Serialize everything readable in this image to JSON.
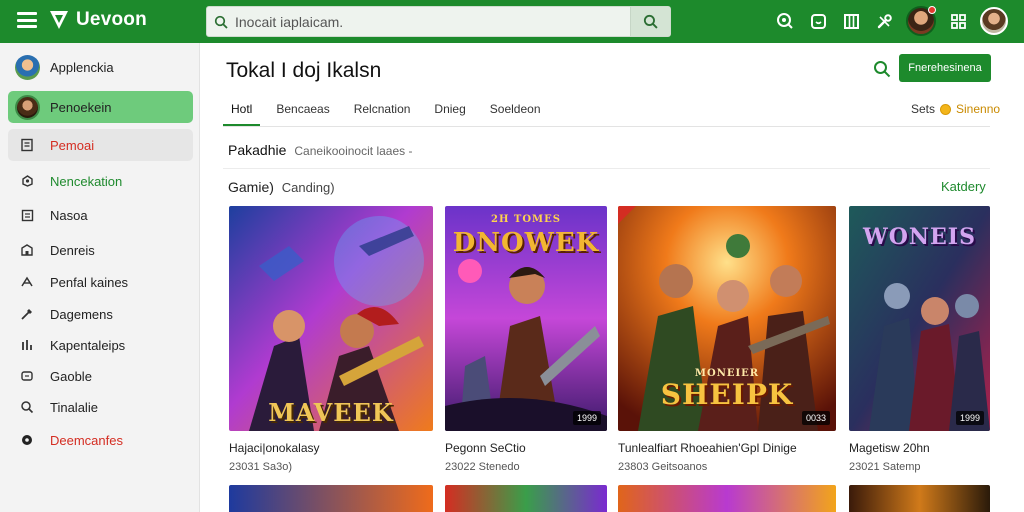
{
  "app": {
    "name": "Uevoon"
  },
  "search": {
    "placeholder": "Inocait iaplaicam."
  },
  "sidebar": {
    "items": [
      {
        "label": "Applenckia",
        "icon": "user-avatar"
      },
      {
        "label": "Penoekein",
        "icon": "user-avatar"
      },
      {
        "label": "Pemoai",
        "icon": "store-icon"
      },
      {
        "label": "Nencekation",
        "icon": "gamepad-icon"
      },
      {
        "label": "Nasoa",
        "icon": "list-icon"
      },
      {
        "label": "Denreis",
        "icon": "building-icon"
      },
      {
        "label": "Penfal kaines",
        "icon": "puzzle-icon"
      },
      {
        "label": "Dagemens",
        "icon": "tools-icon"
      },
      {
        "label": "Kapentaleips",
        "icon": "chart-icon"
      },
      {
        "label": "Gaoble",
        "icon": "cart-icon"
      },
      {
        "label": "Tinalalie",
        "icon": "search-icon"
      },
      {
        "label": "Deemcanfes",
        "icon": "record-icon"
      }
    ]
  },
  "main": {
    "title": "Tokal I doj Ikalsn",
    "action_button": "Fnerehesinena",
    "tabs": [
      "Hotl",
      "Bencaeas",
      "Relcnation",
      "Dnieg",
      "Soeldeon"
    ],
    "tabs_right": {
      "prefix": "Sets",
      "label": "Sinenno"
    },
    "section": {
      "title": "Pakadhie",
      "subtitle": "Caneikooinocit laaes -"
    },
    "category": {
      "title": "Gamie)",
      "subtitle": "Canding)",
      "link": "Katdery"
    }
  },
  "cards": [
    {
      "cover_title": "MAVEEK",
      "cover_top": "",
      "badge": "",
      "title": "Hajaci|onokalasy",
      "subtitle": "23031 Sa3o)"
    },
    {
      "cover_title": "DNOWEK",
      "cover_top": "2H TOMES",
      "badge": "1999",
      "title": "Pegonn SeCtio",
      "subtitle": "23022 Stenedo"
    },
    {
      "cover_title": "SHEIPK",
      "cover_top": "MONEIER",
      "badge": "0033",
      "title": "Tunlealfiart Rhoeahien'Gpl Dinige",
      "subtitle": "23803 Geitsoanos"
    },
    {
      "cover_title": "WONEIS",
      "cover_top": "",
      "badge": "1999",
      "title": "Magetisw 20hn",
      "subtitle": "23021 Satemp"
    }
  ],
  "colors": {
    "brand": "#1d8a2c",
    "active_nav": "#6ecb7c",
    "accent_red": "#d42d22"
  }
}
